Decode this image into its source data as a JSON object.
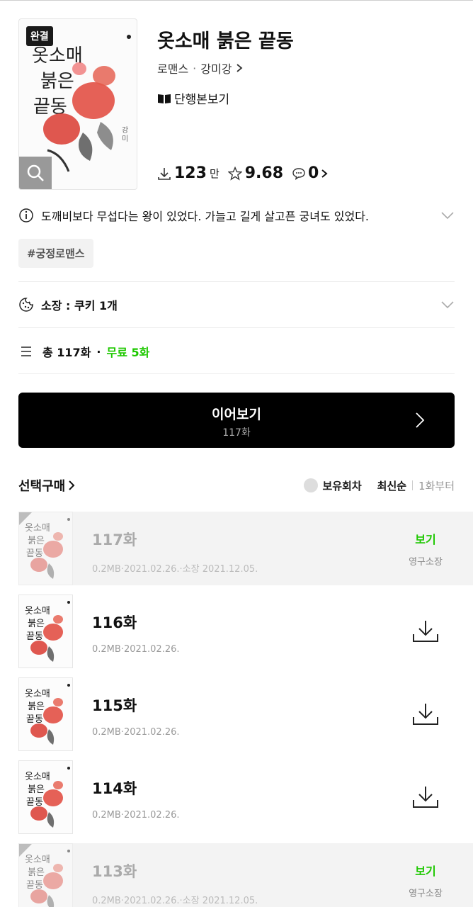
{
  "book": {
    "badge": "완결",
    "title": "옷소매 붉은 끝동",
    "genre": "로맨스",
    "author": "강미강",
    "single_view": "단행본보기",
    "downloads": "123",
    "downloads_unit": "만",
    "rating": "9.68",
    "comments": "0",
    "description": "도깨비보다 무섭다는 왕이 있었다. 가늘고 길게 살고픈 궁녀도 있었다.",
    "tag": "#궁정로맨스"
  },
  "owned": {
    "label": "소장 : 쿠키 1개"
  },
  "totals": {
    "total": "총 117화",
    "free": "무료 5화"
  },
  "continue": {
    "label": "이어보기",
    "episode": "117화"
  },
  "controls": {
    "select_buy": "선택구매",
    "owned_filter": "보유회차",
    "sort_latest": "최신순",
    "sort_first": "1화부터"
  },
  "episodes": [
    {
      "number": "117화",
      "info": "0.2MB·2021.02.26.·소장 2021.12.05.",
      "action": "보기",
      "status": "영구소장",
      "owned": true
    },
    {
      "number": "116화",
      "info": "0.2MB·2021.02.26.",
      "owned": false
    },
    {
      "number": "115화",
      "info": "0.2MB·2021.02.26.",
      "owned": false
    },
    {
      "number": "114화",
      "info": "0.2MB·2021.02.26.",
      "owned": false
    },
    {
      "number": "113화",
      "info": "0.2MB·2021.02.26.·소장 2021.12.05.",
      "action": "보기",
      "status": "영구소장",
      "owned": true
    }
  ],
  "colors": {
    "accent_green": "#1ec800",
    "button_bg": "#000000"
  },
  "icons": {
    "download": "download-icon",
    "star": "star-icon",
    "comment": "comment-icon",
    "info": "info-icon",
    "cookie": "cookie-icon",
    "list": "list-icon",
    "book": "book-icon"
  }
}
